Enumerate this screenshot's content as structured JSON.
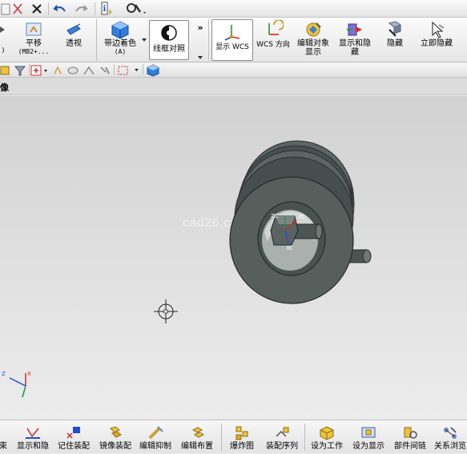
{
  "ribbon": {
    "pan": {
      "label": "平移",
      "sub": "(MB2+..."
    },
    "perspective": {
      "label": "透视"
    },
    "shaded_edges": {
      "label": "带边着色",
      "sub": "(A)"
    },
    "wireframe": {
      "label": "线框对照"
    },
    "show_wcs": {
      "label": "显示 WCS"
    },
    "wcs_direction": {
      "label": "WCS 方向"
    },
    "edit_display": {
      "label": "编辑对象",
      "label2": "显示"
    },
    "show_hide": {
      "label": "显示和隐",
      "label2": "藏"
    },
    "hide": {
      "label": "隐藏"
    },
    "immediate_hide": {
      "label": "立即隐藏"
    },
    "more": "»"
  },
  "small_toolbar": {
    "left_frag": ")"
  },
  "section_header": {
    "label": "像"
  },
  "viewport": {
    "watermark": "cad26.com",
    "triad_labels": {
      "z": "Z",
      "x": "X"
    },
    "csys_labels": {
      "zc": "ZC",
      "yc": "YC",
      "xc": "XC"
    }
  },
  "bottom_toolbar": {
    "items": [
      {
        "label": "束"
      },
      {
        "label": "显示和隐"
      },
      {
        "label": "记住装配"
      },
      {
        "label": "镜像装配"
      },
      {
        "label": "编辑抑制"
      },
      {
        "label": "编辑布置"
      },
      {
        "label": "爆炸图"
      },
      {
        "label": "装配序列"
      },
      {
        "label": "设为工作"
      },
      {
        "label": "设为显示"
      },
      {
        "label": "部件间链"
      },
      {
        "label": "关系浏览"
      }
    ]
  },
  "colors": {
    "part": "#525a58",
    "accent": "#1a6fd6"
  }
}
